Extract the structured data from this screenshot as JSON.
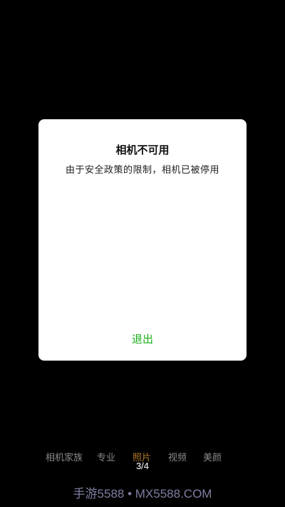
{
  "dialog": {
    "title": "相机不可用",
    "message": "由于安全政策的限制，相机已被停用",
    "exit_label": "退出",
    "exit_color": "#1aad19"
  },
  "modes": {
    "items": [
      {
        "label": "相机家族",
        "active": false
      },
      {
        "label": "专业",
        "active": false
      },
      {
        "label": "照片",
        "active": true
      },
      {
        "label": "视频",
        "active": false
      },
      {
        "label": "美颜",
        "active": false
      }
    ],
    "active_color": "#b07a2a"
  },
  "page_indicator": "3/4",
  "watermark": "手游5588 • MX5588.COM"
}
